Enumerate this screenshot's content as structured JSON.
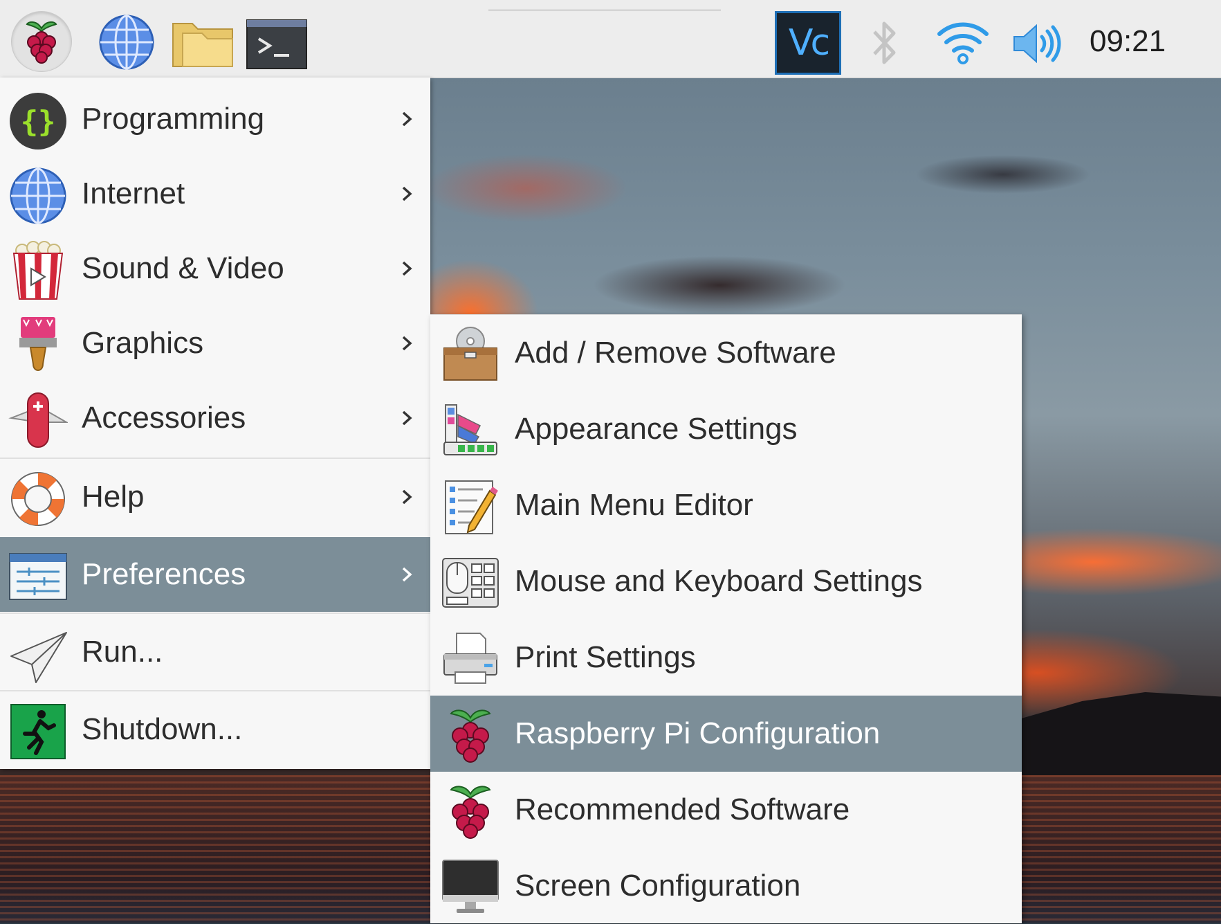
{
  "panel": {
    "clock": "09:21",
    "vnc_label": "Vc"
  },
  "main_menu": {
    "items": [
      {
        "label": "Programming",
        "icon": "braces-icon",
        "submenu": true
      },
      {
        "label": "Internet",
        "icon": "globe-icon",
        "submenu": true
      },
      {
        "label": "Sound & Video",
        "icon": "popcorn-icon",
        "submenu": true
      },
      {
        "label": "Graphics",
        "icon": "paintbrush-icon",
        "submenu": true
      },
      {
        "label": "Accessories",
        "icon": "pocketknife-icon",
        "submenu": true
      },
      {
        "label": "Help",
        "icon": "lifebuoy-icon",
        "submenu": true
      },
      {
        "label": "Preferences",
        "icon": "settings-sliders-icon",
        "submenu": true,
        "selected": true
      },
      {
        "label": "Run...",
        "icon": "paper-plane-icon",
        "submenu": false
      },
      {
        "label": "Shutdown...",
        "icon": "exit-running-man-icon",
        "submenu": false
      }
    ]
  },
  "preferences_submenu": {
    "items": [
      {
        "label": "Add / Remove Software",
        "icon": "software-box-icon"
      },
      {
        "label": "Appearance Settings",
        "icon": "color-palette-icon"
      },
      {
        "label": "Main Menu Editor",
        "icon": "menu-editor-icon"
      },
      {
        "label": "Mouse and Keyboard Settings",
        "icon": "mouse-keyboard-icon"
      },
      {
        "label": "Print Settings",
        "icon": "printer-icon"
      },
      {
        "label": "Raspberry Pi Configuration",
        "icon": "raspberry-icon",
        "selected": true
      },
      {
        "label": "Recommended Software",
        "icon": "raspberry-icon"
      },
      {
        "label": "Screen Configuration",
        "icon": "monitor-icon"
      }
    ]
  },
  "colors": {
    "selection": "#7c8e98",
    "menu_bg": "#f7f7f7",
    "panel_bg": "#ededed",
    "vnc_accent": "#1e6fb6"
  }
}
